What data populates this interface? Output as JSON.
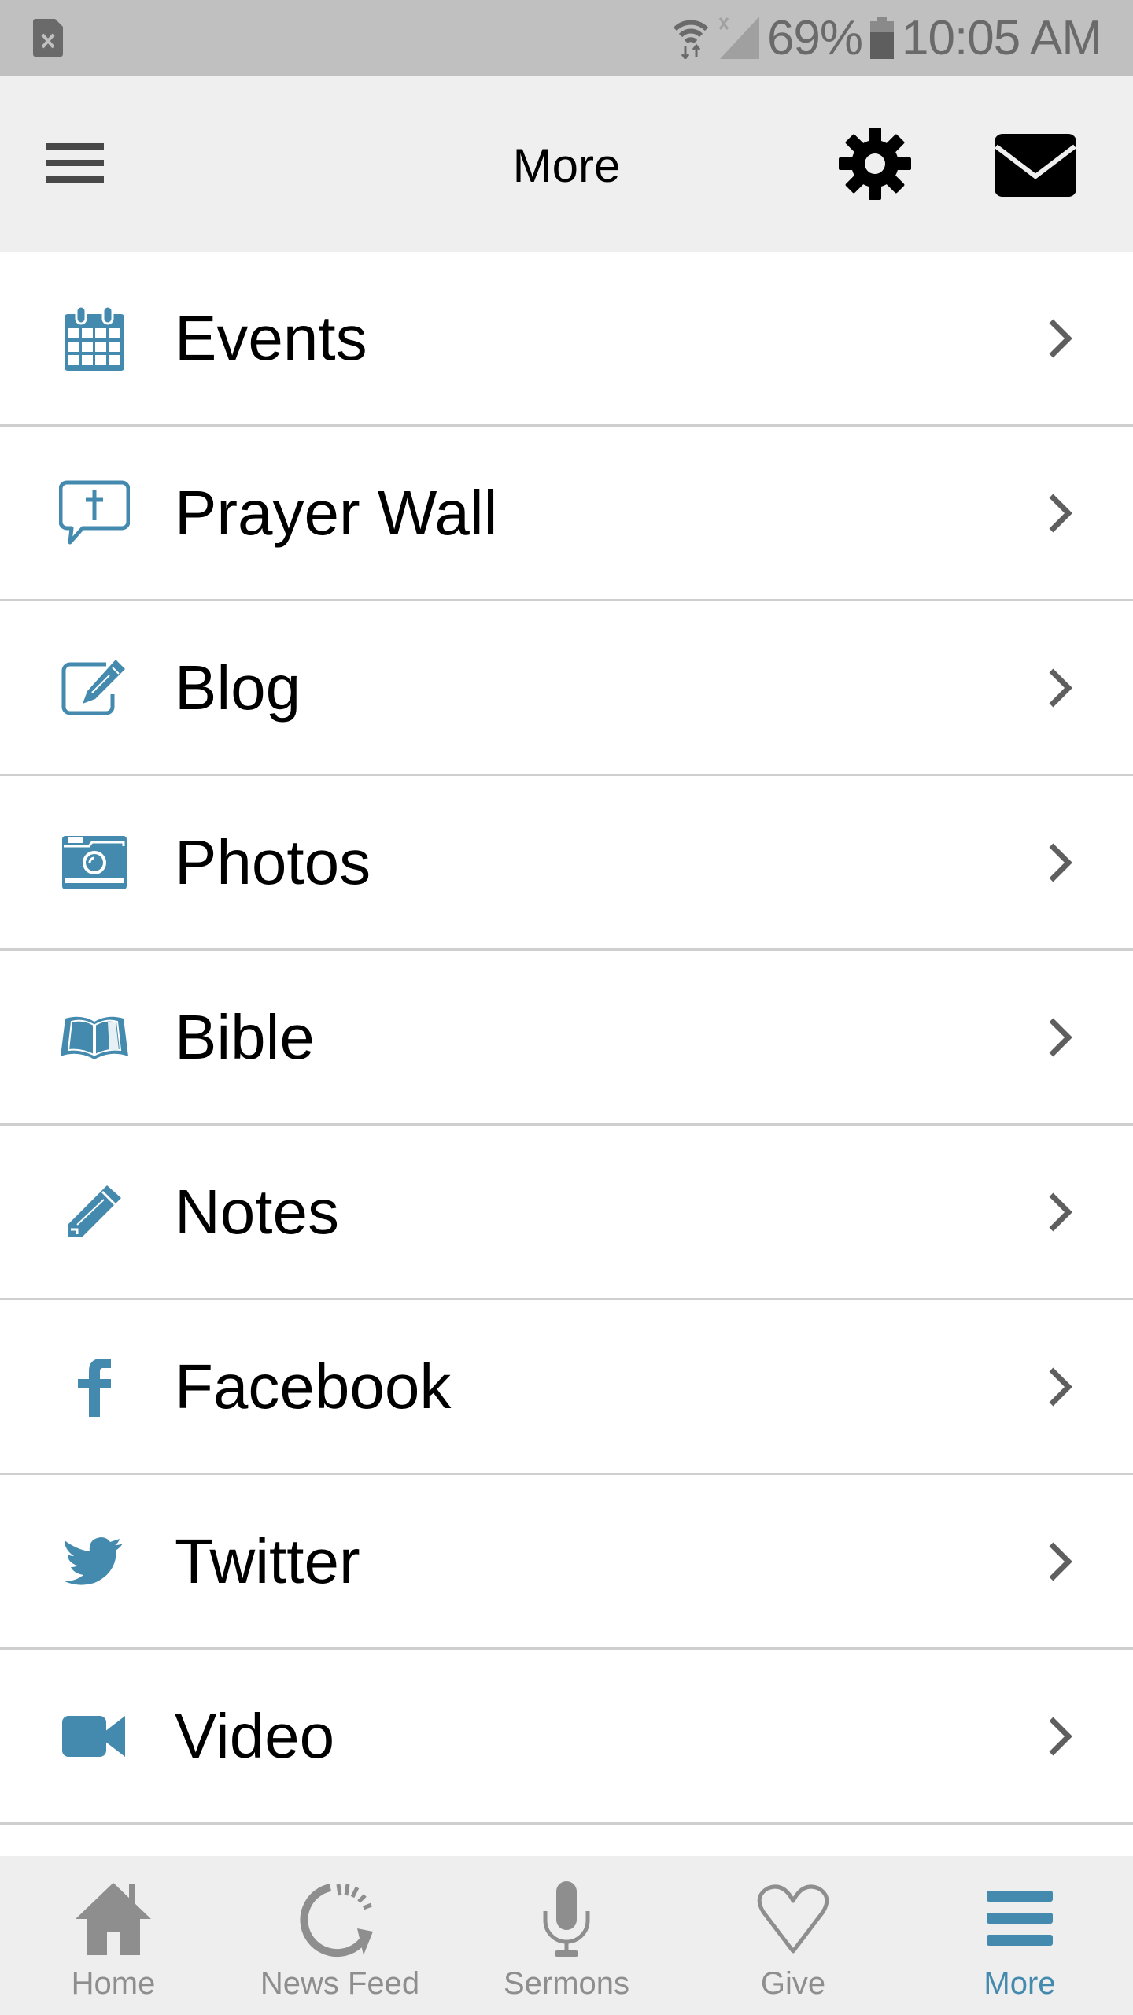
{
  "status_bar": {
    "battery_percent": "69%",
    "time": "10:05 AM",
    "icons": [
      "sim-error-icon",
      "wifi-icon",
      "signal-no-service-icon",
      "battery-icon"
    ]
  },
  "header": {
    "title": "More",
    "left_icon": "hamburger-menu-icon",
    "right_icons": [
      "gear-icon",
      "mail-icon"
    ]
  },
  "colors": {
    "accent": "#448aaf",
    "header_bg": "#efefef",
    "status_bar_bg": "#c0c0c0",
    "tab_inactive": "#8e8e8e",
    "divider": "#cfcfcf",
    "chevron": "#5f5f5f"
  },
  "menu": {
    "items": [
      {
        "label": "Events",
        "icon": "calendar-icon"
      },
      {
        "label": "Prayer Wall",
        "icon": "prayer-bubble-icon"
      },
      {
        "label": "Blog",
        "icon": "edit-square-icon"
      },
      {
        "label": "Photos",
        "icon": "camera-icon"
      },
      {
        "label": "Bible",
        "icon": "open-book-icon"
      },
      {
        "label": "Notes",
        "icon": "pencil-icon"
      },
      {
        "label": "Facebook",
        "icon": "facebook-icon"
      },
      {
        "label": "Twitter",
        "icon": "twitter-icon"
      },
      {
        "label": "Video",
        "icon": "video-camera-icon"
      }
    ]
  },
  "tabbar": {
    "tabs": [
      {
        "label": "Home",
        "icon": "home-icon",
        "active": false
      },
      {
        "label": "News Feed",
        "icon": "refresh-icon",
        "active": false
      },
      {
        "label": "Sermons",
        "icon": "microphone-icon",
        "active": false
      },
      {
        "label": "Give",
        "icon": "heart-icon",
        "active": false
      },
      {
        "label": "More",
        "icon": "hamburger-menu-icon",
        "active": true
      }
    ]
  }
}
